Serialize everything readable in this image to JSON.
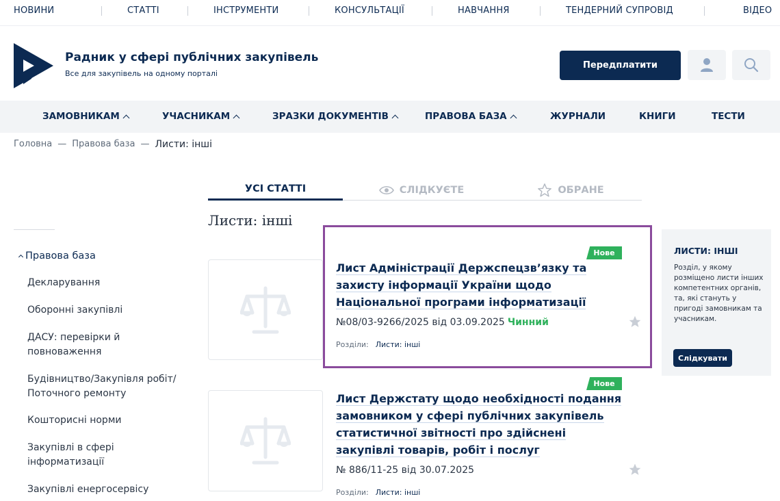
{
  "top_nav": [
    "НОВИНИ",
    "СТАТТІ",
    "ІНСТРУМЕНТИ",
    "КОНСУЛЬТАЦІЇ",
    "НАВЧАННЯ",
    "ТЕНДЕРНИЙ СУПРОВІД",
    "ВІДЕО"
  ],
  "header": {
    "title": "Радник у сфері публічних закупівель",
    "subtitle": "Все для закупівель на одному порталі",
    "subscribe_label": "Передплатити",
    "user_icon": "user-icon",
    "search_icon": "search-icon"
  },
  "main_nav": [
    {
      "label": "ЗАМОВНИКАМ"
    },
    {
      "label": "УЧАСНИКАМ"
    },
    {
      "label": "ЗРАЗКИ ДОКУМЕНТІВ"
    },
    {
      "label": "ПРАВОВА БАЗА"
    },
    {
      "label": "ЖУРНАЛИ"
    },
    {
      "label": "КНИГИ"
    },
    {
      "label": "ТЕСТИ"
    }
  ],
  "breadcrumb": {
    "home": "Головна",
    "sep": "—",
    "parent": "Правова база",
    "current": "Листи: інші"
  },
  "tabs": {
    "all": "УСІ СТАТТІ",
    "following": "СЛІДКУЄТЕ",
    "favorites": "ОБРАНЕ"
  },
  "section_title": "Листи: інші",
  "sidebar": {
    "root": "Правова база",
    "items": [
      "Декларування",
      "Оборонні закупівлі",
      "ДАСУ: перевірки й повноваження",
      "Будівництво/Закупівля робіт/ Поточного ремонту",
      "Кошторисні норми",
      "Закупівлі в сфері інформатизації",
      "Закупівлі енергосервісу"
    ]
  },
  "articles": [
    {
      "badge": "Нове",
      "title": "Лист Адміністрації Держспецзв’язку та захисту інформації України щодо Національної програми інформатизації",
      "meta": "№08/03-9266/2025 від 03.09.2025",
      "status": "Чинний",
      "sections_label": "Розділи:",
      "section_link": "Листи: інші"
    },
    {
      "badge": "Нове",
      "title": "Лист Держстату щодо необхідності подання замовником у сфері публічних закупівель статистичної звітності про здійснені закупівлі товарів, робіт і послуг",
      "meta": "№ 886/11-25 від 30.07.2025",
      "status": "",
      "sections_label": "Розділи:",
      "section_link": "Листи: інші"
    }
  ],
  "info_box": {
    "title": "ЛИСТИ: ІНШІ",
    "text": "Розділ, у якому розміщено листи інших компетентних органів, та, які стануть у пригоді замовникам та учасникам.",
    "button": "Слідкувати"
  },
  "colors": {
    "brand": "#0c2a52",
    "badge_green": "#2fb15c",
    "highlight": "#8a4b9c"
  }
}
